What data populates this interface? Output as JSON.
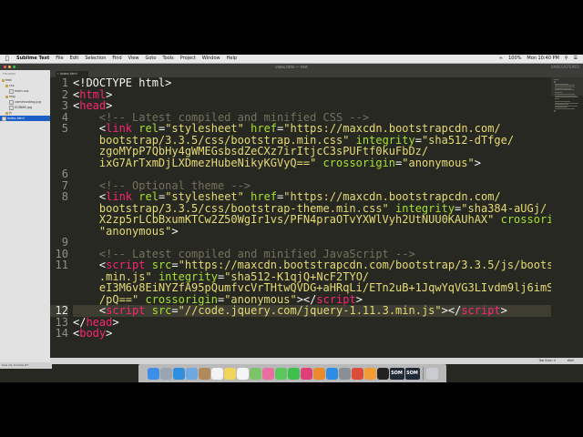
{
  "menubar": {
    "apple": "",
    "items": [
      "Sublime Text",
      "File",
      "Edit",
      "Selection",
      "Find",
      "View",
      "Goto",
      "Tools",
      "Project",
      "Window",
      "Help"
    ],
    "battery": "100%",
    "clock": "Mon 10:40 PM"
  },
  "window": {
    "title": "index.html — test",
    "user": "UNREGISTERED"
  },
  "sidebar": {
    "header": "FOLDERS",
    "items": [
      {
        "label": "test",
        "type": "folder"
      },
      {
        "label": "css",
        "type": "folder"
      },
      {
        "label": "main.css",
        "type": "file"
      },
      {
        "label": "img",
        "type": "folder"
      },
      {
        "label": "camelcoding.jpg",
        "type": "file"
      },
      {
        "label": "IG3866.jpg",
        "type": "file"
      },
      {
        "label": "js",
        "type": "folder"
      },
      {
        "label": "index.html",
        "type": "file",
        "selected": true
      }
    ]
  },
  "tabs": [
    {
      "label": "index.html",
      "close": "×"
    }
  ],
  "editor": {
    "current_line": 12,
    "lines": [
      {
        "n": "1",
        "tokens": [
          {
            "t": "<!DOCTYPE html>",
            "c": "txt"
          }
        ]
      },
      {
        "n": "2",
        "tokens": [
          {
            "t": "<",
            "c": "txt"
          },
          {
            "t": "html",
            "c": "tg"
          },
          {
            "t": ">",
            "c": "txt"
          }
        ]
      },
      {
        "n": "3",
        "tokens": [
          {
            "t": "<",
            "c": "txt"
          },
          {
            "t": "head",
            "c": "tg"
          },
          {
            "t": ">",
            "c": "txt"
          }
        ]
      },
      {
        "n": "4",
        "tokens": [
          {
            "t": "    <!-- Latest compiled and minified CSS -->",
            "c": "cm"
          }
        ]
      },
      {
        "n": "5",
        "tokens": [
          {
            "t": "    <",
            "c": "txt"
          },
          {
            "t": "link",
            "c": "tg"
          },
          {
            "t": " ",
            "c": "txt"
          },
          {
            "t": "rel",
            "c": "at"
          },
          {
            "t": "=",
            "c": "txt"
          },
          {
            "t": "\"stylesheet\"",
            "c": "st"
          },
          {
            "t": " ",
            "c": "txt"
          },
          {
            "t": "href",
            "c": "at"
          },
          {
            "t": "=",
            "c": "txt"
          },
          {
            "t": "\"https://maxcdn.bootstrapcdn.com/",
            "c": "st"
          }
        ]
      },
      {
        "n": "",
        "tokens": [
          {
            "t": "    bootstrap/3.3.5/css/bootstrap.min.css\"",
            "c": "st"
          },
          {
            "t": " ",
            "c": "txt"
          },
          {
            "t": "integrity",
            "c": "at"
          },
          {
            "t": "=",
            "c": "txt"
          },
          {
            "t": "\"sha512-dTfge/",
            "c": "st"
          }
        ]
      },
      {
        "n": "",
        "tokens": [
          {
            "t": "    zgoMYpP7QbHy4gWMEGsbsdZeCXz7irItjcC3sPUFtf0kuFbDz/",
            "c": "st"
          }
        ]
      },
      {
        "n": "",
        "tokens": [
          {
            "t": "    ixG7ArTxmDjLXDmezHubeNikyKGVyQ==\"",
            "c": "st"
          },
          {
            "t": " ",
            "c": "txt"
          },
          {
            "t": "crossorigin",
            "c": "at"
          },
          {
            "t": "=",
            "c": "txt"
          },
          {
            "t": "\"anonymous\"",
            "c": "st"
          },
          {
            "t": ">",
            "c": "txt"
          }
        ]
      },
      {
        "n": "6",
        "tokens": [
          {
            "t": "",
            "c": "txt"
          }
        ]
      },
      {
        "n": "7",
        "tokens": [
          {
            "t": "    <!-- Optional theme -->",
            "c": "cm"
          }
        ]
      },
      {
        "n": "8",
        "tokens": [
          {
            "t": "    <",
            "c": "txt"
          },
          {
            "t": "link",
            "c": "tg"
          },
          {
            "t": " ",
            "c": "txt"
          },
          {
            "t": "rel",
            "c": "at"
          },
          {
            "t": "=",
            "c": "txt"
          },
          {
            "t": "\"stylesheet\"",
            "c": "st"
          },
          {
            "t": " ",
            "c": "txt"
          },
          {
            "t": "href",
            "c": "at"
          },
          {
            "t": "=",
            "c": "txt"
          },
          {
            "t": "\"https://maxcdn.bootstrapcdn.com/",
            "c": "st"
          }
        ]
      },
      {
        "n": "",
        "tokens": [
          {
            "t": "    bootstrap/3.3.5/css/bootstrap-theme.min.css\"",
            "c": "st"
          },
          {
            "t": " ",
            "c": "txt"
          },
          {
            "t": "integrity",
            "c": "at"
          },
          {
            "t": "=",
            "c": "txt"
          },
          {
            "t": "\"sha384-aUGj/",
            "c": "st"
          }
        ]
      },
      {
        "n": "",
        "tokens": [
          {
            "t": "    X2zp5rLCbBxumKTCw2Z50WgIr1vs/PFN4praOTvYXWlVyh2UtNUU0KAUhAX\"",
            "c": "st"
          },
          {
            "t": " ",
            "c": "txt"
          },
          {
            "t": "crossorigin",
            "c": "at"
          },
          {
            "t": "=",
            "c": "txt"
          }
        ]
      },
      {
        "n": "",
        "tokens": [
          {
            "t": "    \"anonymous\"",
            "c": "st"
          },
          {
            "t": ">",
            "c": "txt"
          }
        ]
      },
      {
        "n": "9",
        "tokens": [
          {
            "t": "",
            "c": "txt"
          }
        ]
      },
      {
        "n": "10",
        "tokens": [
          {
            "t": "    <!-- Latest compiled and minified JavaScript -->",
            "c": "cm"
          }
        ]
      },
      {
        "n": "11",
        "tokens": [
          {
            "t": "    <",
            "c": "txt"
          },
          {
            "t": "script",
            "c": "tg"
          },
          {
            "t": " ",
            "c": "txt"
          },
          {
            "t": "src",
            "c": "at"
          },
          {
            "t": "=",
            "c": "txt"
          },
          {
            "t": "\"https://maxcdn.bootstrapcdn.com/bootstrap/3.3.5/js/bootstrap",
            "c": "st"
          }
        ]
      },
      {
        "n": "",
        "tokens": [
          {
            "t": "    .min.js\"",
            "c": "st"
          },
          {
            "t": " ",
            "c": "txt"
          },
          {
            "t": "integrity",
            "c": "at"
          },
          {
            "t": "=",
            "c": "txt"
          },
          {
            "t": "\"sha512-K1qjQ+NcF2TYO/",
            "c": "st"
          }
        ]
      },
      {
        "n": "",
        "tokens": [
          {
            "t": "    eI3M6v8EiNYZfA95pQumfvcVrTHtwQVDG+aHRqLi/ETn2uB+1JqwYqVG3LIvdm9lj6imS",
            "c": "st"
          }
        ]
      },
      {
        "n": "",
        "tokens": [
          {
            "t": "    /pQ==\"",
            "c": "st"
          },
          {
            "t": " ",
            "c": "txt"
          },
          {
            "t": "crossorigin",
            "c": "at"
          },
          {
            "t": "=",
            "c": "txt"
          },
          {
            "t": "\"anonymous\"",
            "c": "st"
          },
          {
            "t": "></",
            "c": "txt"
          },
          {
            "t": "script",
            "c": "tg"
          },
          {
            "t": ">",
            "c": "txt"
          }
        ]
      },
      {
        "n": "12",
        "tokens": [
          {
            "t": "    <",
            "c": "txt"
          },
          {
            "t": "script",
            "c": "tg"
          },
          {
            "t": " ",
            "c": "txt"
          },
          {
            "t": "src",
            "c": "at"
          },
          {
            "t": "=",
            "c": "txt"
          },
          {
            "t": "\"//code.jquery.com/jquery-1.11.3.min.js\"",
            "c": "st"
          },
          {
            "t": "></",
            "c": "txt"
          },
          {
            "t": "script",
            "c": "tg"
          },
          {
            "t": ">",
            "c": "txt"
          }
        ]
      },
      {
        "n": "13",
        "tokens": [
          {
            "t": "</",
            "c": "txt"
          },
          {
            "t": "head",
            "c": "tg"
          },
          {
            "t": ">",
            "c": "txt"
          }
        ]
      },
      {
        "n": "14",
        "tokens": [
          {
            "t": "<",
            "c": "txt"
          },
          {
            "t": "body",
            "c": "tg"
          },
          {
            "t": ">",
            "c": "txt"
          }
        ]
      }
    ]
  },
  "statusbar": {
    "position": "Line 12, Column 67",
    "tab_size": "Tab Size: 4",
    "syntax": "Well"
  },
  "dock": {
    "icons": [
      {
        "name": "finder-icon",
        "color": "#3d8ee8"
      },
      {
        "name": "launchpad-icon",
        "color": "#9aa4b1"
      },
      {
        "name": "safari-icon",
        "color": "#2e8fe0"
      },
      {
        "name": "mail-icon",
        "color": "#6fa8e0"
      },
      {
        "name": "contacts-icon",
        "color": "#b08a5a"
      },
      {
        "name": "calendar-icon",
        "color": "#f3f3f3"
      },
      {
        "name": "notes-icon",
        "color": "#f2d45c"
      },
      {
        "name": "reminders-icon",
        "color": "#f5f5f5"
      },
      {
        "name": "maps-icon",
        "color": "#7cc46a"
      },
      {
        "name": "photos-icon",
        "color": "#e86fa0"
      },
      {
        "name": "messages-icon",
        "color": "#5ac85a"
      },
      {
        "name": "facetime-icon",
        "color": "#3fbf4c"
      },
      {
        "name": "itunes-icon",
        "color": "#e0407a"
      },
      {
        "name": "ibooks-icon",
        "color": "#e98b2c"
      },
      {
        "name": "app-store-icon",
        "color": "#2d8de6"
      },
      {
        "name": "system-preferences-icon",
        "color": "#8a8f96"
      },
      {
        "name": "chrome-icon",
        "color": "#dd4b39"
      },
      {
        "name": "sublime-text-icon",
        "color": "#f39c33"
      },
      {
        "name": "terminal-icon",
        "color": "#222222"
      }
    ],
    "text_tiles": [
      "SOM",
      "SOM"
    ],
    "trash": {
      "name": "trash-icon",
      "color": "#c9ccd1"
    }
  }
}
